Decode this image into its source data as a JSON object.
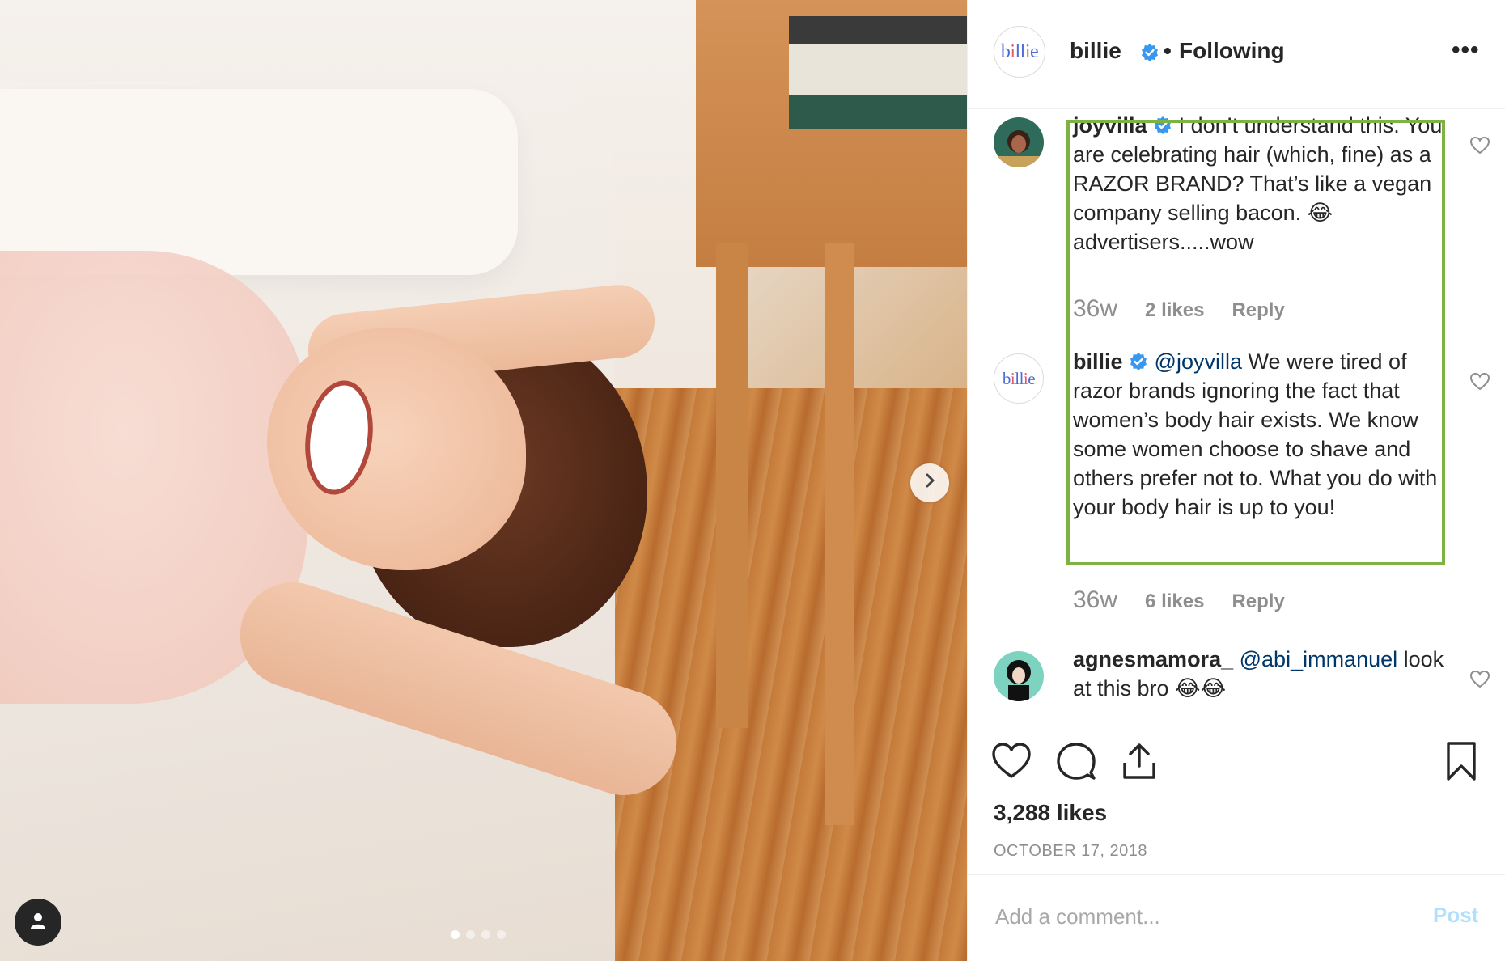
{
  "header": {
    "username": "billie",
    "bullet": "•",
    "follow_status": "Following",
    "more": "•••"
  },
  "brand_logo_text": "billie",
  "comments": [
    {
      "username": "joyvilla",
      "verified": true,
      "text": "I don’t understand this. You are celebrating hair (which, fine) as a RAZOR BRAND? That’s like a vegan company selling bacon. 😂 advertisers.....wow",
      "time": "36w",
      "likes": "2 likes",
      "reply": "Reply"
    },
    {
      "username": "billie",
      "verified": true,
      "mention": "@joyvilla",
      "text": "We were tired of razor brands ignoring the fact that women’s body hair exists. We know some women choose to shave and others prefer not to. What you do with your body hair is up to you!",
      "time": "36w",
      "likes": "6 likes",
      "reply": "Reply"
    },
    {
      "username": "agnesmamora_",
      "mention": "@abi_immanuel",
      "text": "look at this bro 😂😂"
    }
  ],
  "post": {
    "likes": "3,288 likes",
    "date": "OCTOBER 17, 2018"
  },
  "add_comment": {
    "placeholder": "Add a comment...",
    "post_label": "Post"
  },
  "carousel": {
    "count": 4,
    "active_index": 0
  },
  "colors": {
    "verified": "#3897f0",
    "highlight": "#7cb342",
    "mention": "#00376b",
    "post_disabled": "#b2dffc"
  },
  "icons": [
    "heart-icon",
    "comment-icon",
    "share-icon",
    "bookmark-icon",
    "chevron-right-icon",
    "user-tag-icon",
    "more-icon",
    "verified-icon"
  ]
}
